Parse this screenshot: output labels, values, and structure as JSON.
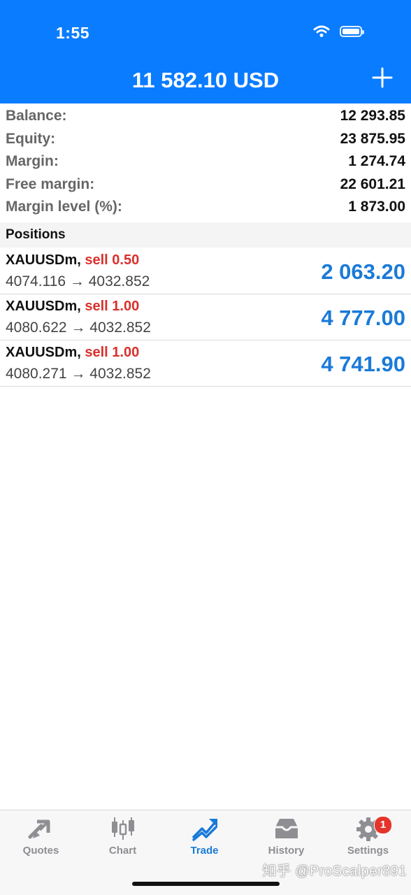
{
  "status_bar": {
    "time": "1:55",
    "wifi_icon": "wifi-icon",
    "battery_icon": "battery-icon"
  },
  "header": {
    "title": "11 582.10 USD",
    "add_icon": "plus-icon"
  },
  "summary": [
    {
      "label": "Balance:",
      "value": "12 293.85"
    },
    {
      "label": "Equity:",
      "value": "23 875.95"
    },
    {
      "label": "Margin:",
      "value": "1 274.74"
    },
    {
      "label": "Free margin:",
      "value": "22 601.21"
    },
    {
      "label": "Margin level (%):",
      "value": "1 873.00"
    }
  ],
  "positions": {
    "title": "Positions",
    "items": [
      {
        "symbol": "XAUUSDm,",
        "side": "sell 0.50",
        "open": "4074.116",
        "arrow": "→",
        "current": "4032.852",
        "profit": "2 063.20"
      },
      {
        "symbol": "XAUUSDm,",
        "side": "sell 1.00",
        "open": "4080.622",
        "arrow": "→",
        "current": "4032.852",
        "profit": "4 777.00"
      },
      {
        "symbol": "XAUUSDm,",
        "side": "sell 1.00",
        "open": "4080.271",
        "arrow": "→",
        "current": "4032.852",
        "profit": "4 741.90"
      }
    ]
  },
  "tabbar": {
    "tabs": [
      {
        "label": "Quotes",
        "icon": "quotes-icon",
        "active": false
      },
      {
        "label": "Chart",
        "icon": "candlestick-chart-icon",
        "active": false
      },
      {
        "label": "Trade",
        "icon": "trade-trend-icon",
        "active": true
      },
      {
        "label": "History",
        "icon": "inbox-history-icon",
        "active": false
      },
      {
        "label": "Settings",
        "icon": "gear-icon",
        "active": false,
        "badge": "1"
      }
    ]
  },
  "colors": {
    "accent": "#0a7cff",
    "profit": "#1a7ad8",
    "sell": "#d9302c",
    "inactive_tab": "#8e8e93"
  },
  "watermark": "知乎 @ProScalper891"
}
